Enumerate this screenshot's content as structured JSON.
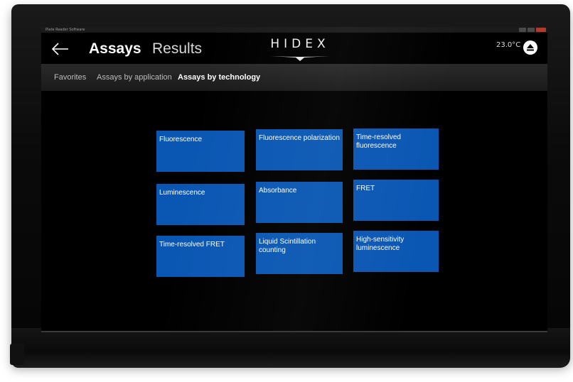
{
  "window": {
    "title": "Plate Reader Software"
  },
  "header": {
    "back_icon": "back-arrow-icon",
    "title_active": "Assays",
    "title_inactive": "Results",
    "logo_text": "HIDEX",
    "temperature": "23.0°C",
    "eject_icon": "eject-icon"
  },
  "nav": {
    "items": [
      {
        "label": "Favorites",
        "active": false
      },
      {
        "label": "Assays by application",
        "active": false
      },
      {
        "label": "Assays by technology",
        "active": true
      }
    ]
  },
  "tiles": [
    {
      "label": "Fluorescence"
    },
    {
      "label": "Fluorescence polarization"
    },
    {
      "label": "Time-resolved fluorescence"
    },
    {
      "label": "Luminescence"
    },
    {
      "label": "Absorbance"
    },
    {
      "label": "FRET"
    },
    {
      "label": "Time-resolved FRET"
    },
    {
      "label": "Liquid Scintillation counting"
    },
    {
      "label": "High-sensitivity luminescence"
    }
  ],
  "colors": {
    "tile": "#0a57b3",
    "background": "#000000",
    "text": "#ffffff"
  }
}
